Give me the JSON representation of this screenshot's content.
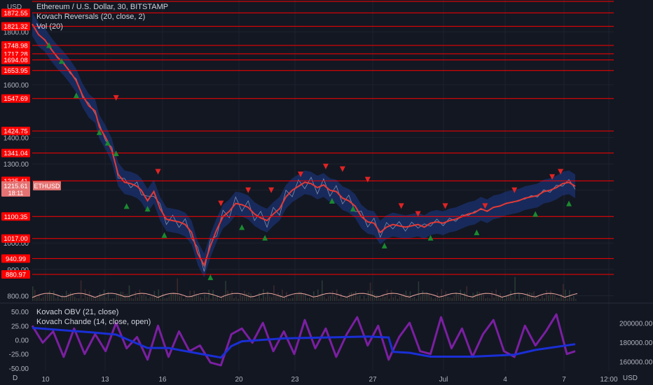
{
  "header": {
    "currency": "USD",
    "symbol_line": "Ethereum / U.S. Dollar, 30, BITSTAMP",
    "indicator_1": "Kovach Reversals (20, close, 2)",
    "indicator_2": "Vol (20)",
    "lower_indicator_1": "Kovach OBV (21, close)",
    "lower_indicator_2": "Kovach Chande (14, close, open)"
  },
  "footer": {
    "timezone_icon": "D",
    "currency_right": "USD"
  },
  "colors": {
    "background": "#131722",
    "level_line": "#ff0000",
    "price_line": "#e53935",
    "band": "#1e3a8a",
    "oscillator": "#7b1fa2",
    "obv": "#1a2fd6",
    "up_marker": "#1b8a2f",
    "down_marker": "#e02424",
    "current_price_tag": "#e57373"
  },
  "chart_data": {
    "type": "line",
    "title": "Ethereum / U.S. Dollar, 30, BITSTAMP",
    "x_ticks": [
      "10",
      "13",
      "16",
      "20",
      "23",
      "27",
      "Jul",
      "4",
      "7",
      "12:00"
    ],
    "y_ticks": [
      "1800.00",
      "1600.00",
      "1400.00",
      "1300.00",
      "1200.00",
      "1100.00",
      "1000.00",
      "900.00",
      "800.00"
    ],
    "horizontal_levels": [
      {
        "label": "1872.55",
        "value": 1872.55
      },
      {
        "label": "1821.32",
        "value": 1821.32
      },
      {
        "label": "1748.98",
        "value": 1748.98
      },
      {
        "label": "1717.28",
        "value": 1717.28
      },
      {
        "label": "1694.08",
        "value": 1694.08
      },
      {
        "label": "1653.95",
        "value": 1653.95
      },
      {
        "label": "1547.69",
        "value": 1547.69
      },
      {
        "label": "1424.75",
        "value": 1424.75
      },
      {
        "label": "1341.04",
        "value": 1341.04
      },
      {
        "label": "1235.41",
        "value": 1235.41
      },
      {
        "label": "1100.35",
        "value": 1100.35
      },
      {
        "label": "1017.00",
        "value": 1017.0
      },
      {
        "label": "940.99",
        "value": 940.99
      },
      {
        "label": "880.97",
        "value": 880.97
      }
    ],
    "current_price": {
      "label": "1215.61",
      "countdown": "18:11",
      "symbol": "ETHUSD",
      "value": 1215.61
    },
    "price_series": {
      "name": "ETHUSD",
      "x": [
        0,
        3,
        6,
        9,
        12,
        15,
        18,
        21,
        24,
        27,
        30,
        32,
        35,
        38,
        41,
        44,
        47,
        50,
        52,
        55,
        58,
        61,
        64,
        67,
        70,
        73,
        76,
        79,
        82,
        85,
        88,
        91,
        94,
        97,
        100,
        103,
        106,
        109,
        112,
        115,
        118,
        121,
        124,
        127,
        130,
        133,
        136,
        139,
        142,
        145,
        148,
        151,
        154,
        157,
        160,
        163,
        166,
        169,
        172
      ],
      "y": [
        1830,
        1790,
        1770,
        1735,
        1705,
        1680,
        1650,
        1615,
        1560,
        1520,
        1500,
        1440,
        1400,
        1350,
        1260,
        1230,
        1225,
        1215,
        1200,
        1160,
        1195,
        1130,
        1090,
        1085,
        1080,
        1070,
        1040,
        960,
        915,
        990,
        1050,
        1100,
        1120,
        1150,
        1145,
        1135,
        1110,
        1095,
        1085,
        1110,
        1130,
        1175,
        1200,
        1215,
        1230,
        1225,
        1210,
        1220,
        1200,
        1195,
        1170,
        1160,
        1140,
        1100,
        1080,
        1075,
        1040,
        1060,
        1070
      ]
    },
    "price_series_2": {
      "x": [
        172,
        175,
        178,
        181,
        184,
        187,
        190,
        193,
        196,
        199,
        202,
        205,
        208,
        211,
        214,
        217,
        220,
        223,
        226,
        229,
        232,
        235,
        238,
        241,
        244,
        247,
        250,
        253,
        256,
        259
      ],
      "y": [
        1070,
        1065,
        1060,
        1065,
        1070,
        1060,
        1075,
        1080,
        1075,
        1085,
        1090,
        1100,
        1110,
        1115,
        1130,
        1120,
        1135,
        1140,
        1150,
        1155,
        1160,
        1170,
        1175,
        1180,
        1195,
        1200,
        1210,
        1225,
        1230,
        1215
      ]
    },
    "oscillator_ticks": [
      "50.00",
      "25.00",
      "0.00",
      "-25.00",
      "-50.00"
    ],
    "obv_ticks": [
      "200000.00",
      "180000.00",
      "160000.00"
    ],
    "oscillator_series": {
      "x": [
        0,
        5,
        10,
        15,
        20,
        25,
        30,
        35,
        40,
        45,
        50,
        55,
        60,
        65,
        70,
        75,
        80,
        85,
        90,
        95,
        100,
        105,
        110,
        115,
        120,
        125,
        130,
        135,
        140,
        145,
        150,
        155,
        160,
        165,
        170,
        175,
        180,
        185,
        190,
        195,
        200,
        205,
        210,
        215,
        220,
        225,
        230,
        235,
        240,
        245,
        250,
        255,
        259
      ],
      "y": [
        25,
        -5,
        15,
        -30,
        20,
        -25,
        10,
        -20,
        30,
        -15,
        5,
        -35,
        25,
        -30,
        15,
        -20,
        -10,
        -40,
        -45,
        10,
        20,
        -5,
        30,
        -20,
        15,
        -25,
        35,
        -15,
        20,
        -30,
        10,
        40,
        -10,
        25,
        -35,
        5,
        30,
        -20,
        -25,
        40,
        -15,
        20,
        -30,
        10,
        35,
        -20,
        -30,
        25,
        -10,
        15,
        45,
        -25,
        -20
      ]
    },
    "obv_series": {
      "x": [
        0,
        30,
        40,
        55,
        65,
        80,
        85,
        90,
        95,
        100,
        120,
        140,
        160,
        170,
        172,
        180,
        190,
        200,
        210,
        230,
        240,
        259
      ],
      "y": [
        195000,
        190000,
        188000,
        174000,
        174000,
        168000,
        166000,
        164000,
        176000,
        181000,
        184000,
        185000,
        186000,
        185000,
        170000,
        169000,
        165000,
        165000,
        165000,
        167000,
        172000,
        178000
      ]
    },
    "up_markers": [
      {
        "x": 8,
        "y": 1750
      },
      {
        "x": 14,
        "y": 1690
      },
      {
        "x": 21,
        "y": 1560
      },
      {
        "x": 32,
        "y": 1420
      },
      {
        "x": 36,
        "y": 1380
      },
      {
        "x": 40,
        "y": 1340
      },
      {
        "x": 45,
        "y": 1140
      },
      {
        "x": 55,
        "y": 1130
      },
      {
        "x": 63,
        "y": 1030
      },
      {
        "x": 85,
        "y": 870
      },
      {
        "x": 100,
        "y": 1060
      },
      {
        "x": 111,
        "y": 1020
      },
      {
        "x": 143,
        "y": 1160
      },
      {
        "x": 153,
        "y": 1130
      },
      {
        "x": 168,
        "y": 990
      },
      {
        "x": 190,
        "y": 1020
      },
      {
        "x": 212,
        "y": 1040
      },
      {
        "x": 240,
        "y": 1110
      },
      {
        "x": 256,
        "y": 1150
      }
    ],
    "down_markers": [
      {
        "x": 40,
        "y": 1550
      },
      {
        "x": 60,
        "y": 1270
      },
      {
        "x": 90,
        "y": 1150
      },
      {
        "x": 103,
        "y": 1200
      },
      {
        "x": 114,
        "y": 1200
      },
      {
        "x": 128,
        "y": 1260
      },
      {
        "x": 140,
        "y": 1290
      },
      {
        "x": 148,
        "y": 1280
      },
      {
        "x": 160,
        "y": 1240
      },
      {
        "x": 176,
        "y": 1140
      },
      {
        "x": 184,
        "y": 1110
      },
      {
        "x": 197,
        "y": 1140
      },
      {
        "x": 216,
        "y": 1140
      },
      {
        "x": 230,
        "y": 1200
      },
      {
        "x": 248,
        "y": 1250
      },
      {
        "x": 252,
        "y": 1270
      }
    ],
    "grid": true
  }
}
